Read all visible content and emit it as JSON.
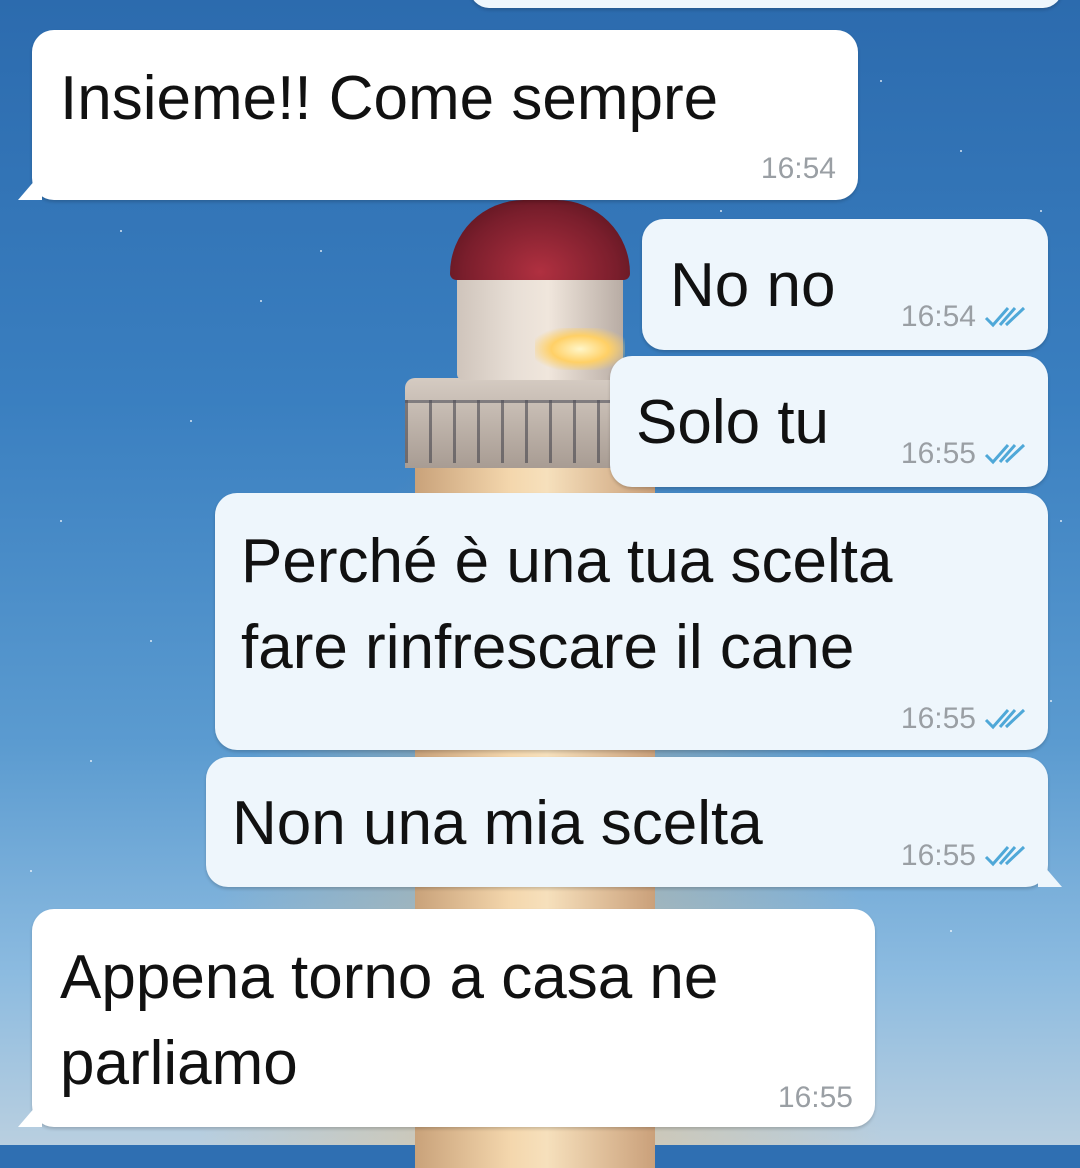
{
  "colors": {
    "incoming_bubble": "#ffffff",
    "outgoing_bubble": "#eef6fc",
    "timestamp": "#9a9fa4",
    "read_ticks": "#4fa8d8"
  },
  "messages": [
    {
      "direction": "incoming",
      "lines": [
        "Insieme!! Come sempre"
      ],
      "time": "16:54"
    },
    {
      "direction": "outgoing",
      "lines": [
        "No no"
      ],
      "time": "16:54",
      "status_icon": "double-check-read-icon"
    },
    {
      "direction": "outgoing",
      "lines": [
        "Solo tu"
      ],
      "time": "16:55",
      "status_icon": "double-check-read-icon"
    },
    {
      "direction": "outgoing",
      "lines": [
        "Perché è una tua scelta",
        "fare rinfrescare il cane"
      ],
      "time": "16:55",
      "status_icon": "double-check-read-icon"
    },
    {
      "direction": "outgoing",
      "lines": [
        "Non una mia scelta"
      ],
      "time": "16:55",
      "status_icon": "double-check-read-icon"
    },
    {
      "direction": "incoming",
      "lines": [
        "Appena torno a casa ne",
        "parliamo"
      ],
      "time": "16:55"
    }
  ]
}
